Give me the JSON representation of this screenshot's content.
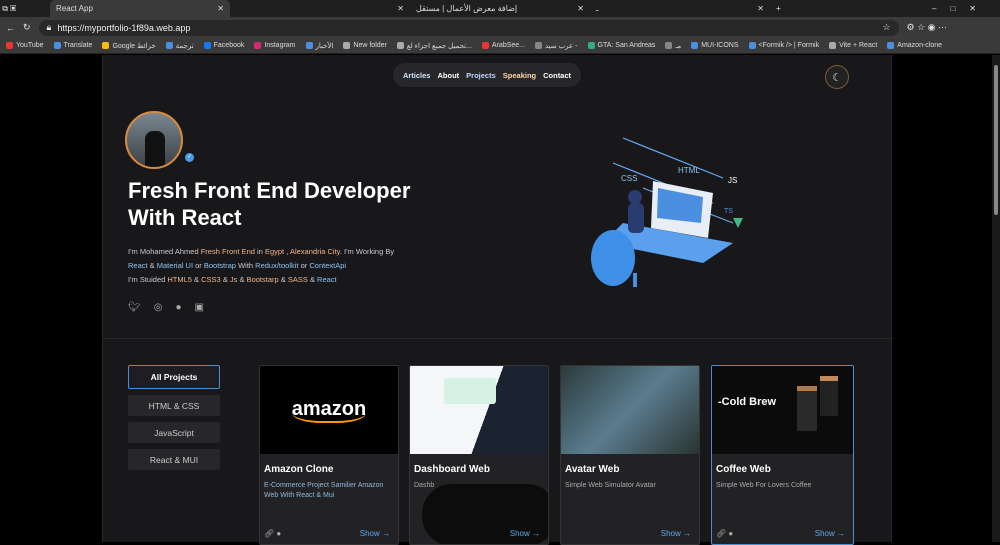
{
  "browser": {
    "tabs": [
      {
        "title": "React App",
        "active": true
      },
      {
        "title": ""
      },
      {
        "title": "إضافة معرض الأعمال | مستقل"
      },
      {
        "title": "ـ"
      }
    ],
    "url": "https://myportfolio-1f89a.web.app",
    "bookmarks": [
      "YouTube",
      "Translate",
      "Google خرائط",
      "ترجمة",
      "Facebook",
      "Instagram",
      "الأخبار",
      "New folder",
      "تحميل جميع اجزاء لع...",
      "ArabSee...",
      "عرب سيد -",
      "GTA: San Andreas",
      "مـ",
      "MUI-ICONS",
      "<Formik /> | Formik",
      "Vite + React",
      "Amazon-clone"
    ]
  },
  "nav": {
    "items": [
      "Articles",
      "About",
      "Projects",
      "Speaking",
      "Contact"
    ],
    "theme_icon": "moon-icon"
  },
  "hero": {
    "title": "Fresh Front End Developer With React",
    "desc": {
      "l1a": "I'm Mohamed Ahmed ",
      "l1b": "Fresh Front End",
      "l1c": " in ",
      "l1d": "Egypt",
      "l1e": " , ",
      "l1f": "Alexandria City",
      "l1g": ". I'm Working By",
      "l2a": "React",
      "l2b": " & ",
      "l2c": "Material UI",
      "l2d": " or ",
      "l2e": "Bootstrap",
      "l2f": " With ",
      "l2g": "Redux/toolkit",
      "l2h": " or ",
      "l2i": "ContextApi",
      "l3a": "I'm Stuided ",
      "l3b": "HTML5",
      "l3c": " & ",
      "l3d": "CSS3",
      "l3e": " & ",
      "l3f": "Js",
      "l3g": " & ",
      "l3h": "Bootstarp",
      "l3i": " & ",
      "l3j": "SASS",
      "l3k": " & ",
      "l3l": "React"
    },
    "illustration_labels": [
      "HTML",
      "CSS",
      "JS",
      "TS"
    ]
  },
  "filters": [
    "All Projects",
    "HTML & CSS",
    "JavaScript",
    "React & MUI"
  ],
  "projects": [
    {
      "title": "Amazon Clone",
      "desc": "E-Commerce Project Samilier Amazon Web With React & Mui",
      "logo": "amazon",
      "show": "Show"
    },
    {
      "title": "Dashboard Web",
      "desc": "Dashb",
      "show": ""
    },
    {
      "title": "Avatar Web",
      "desc": "Simple Web Simulator Avatar",
      "show": "Show"
    },
    {
      "title": "Coffee Web",
      "desc": "Simple Web For Lovers Coffee",
      "hero_text": "-Cold Brew",
      "show": "Show"
    }
  ]
}
